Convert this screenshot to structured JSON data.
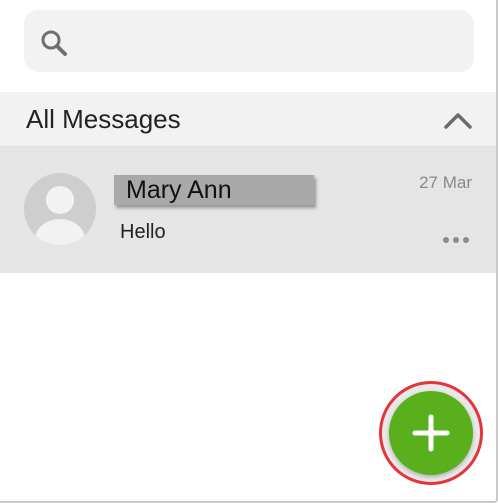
{
  "search": {
    "placeholder": "",
    "icon": "search-icon"
  },
  "section": {
    "title": "All Messages",
    "collapse_icon": "chevron-up-icon"
  },
  "conversations": [
    {
      "name": "Mary Ann",
      "preview": "Hello",
      "date": "27 Mar",
      "avatar_icon": "avatar-placeholder-icon",
      "menu_icon": "more-horizontal-icon"
    }
  ],
  "fab": {
    "icon": "plus-icon",
    "color": "#5ab01c",
    "highlight_color": "#e2363c"
  },
  "colors": {
    "header_bg": "#f2f2f2",
    "row_bg": "#e5e5e5"
  }
}
